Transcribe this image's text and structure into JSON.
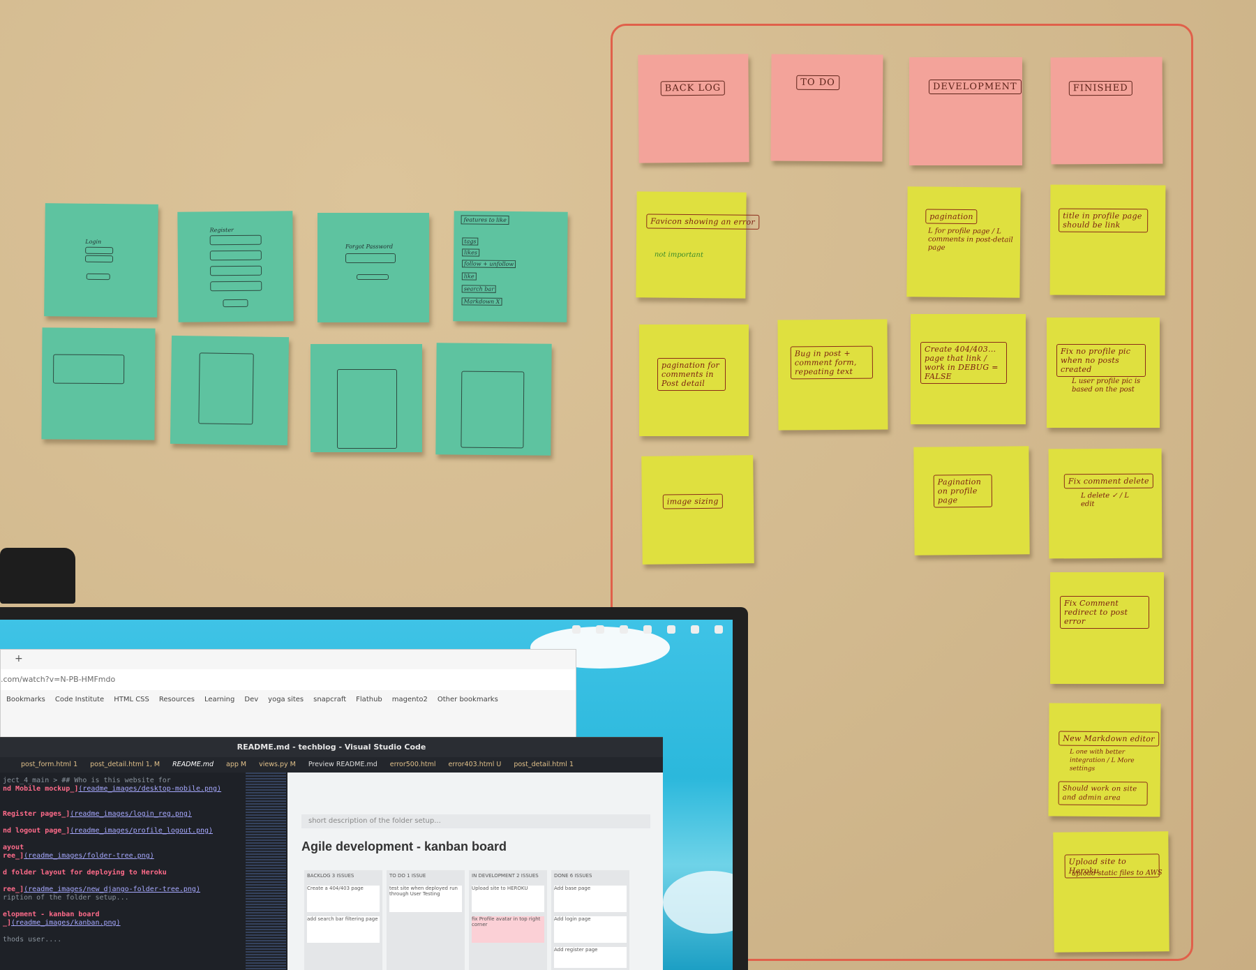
{
  "board": {
    "columns": [
      {
        "label": "BACK LOG"
      },
      {
        "label": "TO DO"
      },
      {
        "label": "DEVELOPMENT"
      },
      {
        "label": "FINISHED"
      }
    ],
    "backlog": [
      {
        "label": "Favicon showing an error",
        "note": "not important"
      },
      {
        "label": "pagination for comments in Post detail"
      },
      {
        "label": "image sizing"
      }
    ],
    "todo": [
      {
        "label": "Bug in post + comment form, repeating text"
      }
    ],
    "development": [
      {
        "label": "pagination",
        "note": "L for profile page / L comments in post-detail page"
      },
      {
        "label": "Create 404/403... page that link / work in DEBUG = FALSE"
      },
      {
        "label": "Pagination on profile page"
      }
    ],
    "finished": [
      {
        "label": "title in profile page should be link"
      },
      {
        "label": "Fix no profile pic when no posts created",
        "note": "L user profile pic is based on the post"
      },
      {
        "label": "Fix comment delete",
        "note": "L delete ✓ / L edit"
      },
      {
        "label": "Fix Comment redirect to post error"
      },
      {
        "label": "New Markdown editor",
        "note": "L one with better integration / L More settings",
        "extra": "Should work on site and admin area"
      },
      {
        "label": "Upload site to Heroku",
        "extra": "upload static files to AWS"
      }
    ]
  },
  "wireframes": {
    "notes": [
      {
        "title": "Login"
      },
      {
        "title": "Register"
      },
      {
        "title": "Forgot Password"
      },
      {
        "title": "features to like",
        "items": [
          "tags",
          "likes",
          "follow + unfollow",
          "like",
          "search bar",
          "Markdown X"
        ]
      }
    ]
  },
  "monitor": {
    "browser": {
      "url": ".com/watch?v=N-PB-HMFmdo",
      "bookmarks": [
        "Bookmarks",
        "Code Institute",
        "HTML CSS",
        "Resources",
        "Learning",
        "Dev",
        "yoga sites",
        "snapcraft",
        "Flathub",
        "magento2",
        "Other bookmarks"
      ]
    },
    "vscode": {
      "title": "README.md - techblog - Visual Studio Code",
      "tabs": [
        "post_form.html 1",
        "post_detail.html 1, M",
        "README.md",
        "app M",
        "views.py M",
        "Preview README.md",
        "error500.html",
        "error403.html U",
        "post_detail.html 1"
      ],
      "breadcrumb": "ject_4_main > ## Who is this website for",
      "lines": [
        {
          "t": "nd Mobile mockup_]",
          "l": "(readme_images/desktop-mobile.png)"
        },
        {
          "t": "Register pages_]",
          "l": "(readme_images/login_reg.png)"
        },
        {
          "t": "nd logout page_]",
          "l": "(readme_images/profile_logout.png)"
        },
        {
          "t": "ayout",
          "l": ""
        },
        {
          "t": "ree_]",
          "l": "(readme_images/folder-tree.png)"
        },
        {
          "t": "d folder layout for deploying to Heroku",
          "l": ""
        },
        {
          "t": "ree_]",
          "l": "(readme_images/new_django-folder-tree.png)"
        },
        {
          "t": "ription of the folder setup...",
          "l": ""
        },
        {
          "t": "elopment - kanban board",
          "l": ""
        },
        {
          "t": "_]",
          "l": "(readme_images/kanban.png)"
        },
        {
          "t": "thods user....",
          "l": ""
        }
      ],
      "preview": {
        "description": "short description of the folder setup...",
        "heading": "Agile development - kanban board",
        "columns": [
          {
            "title": "BACKLOG 3 ISSUES",
            "cards": [
              "Create a 404/403 page",
              "add search bar filtering page"
            ]
          },
          {
            "title": "TO DO 1 ISSUE",
            "cards": [
              "test site when deployed run through User Testing"
            ]
          },
          {
            "title": "IN DEVELOPMENT 2 ISSUES",
            "cards": [
              "Upload site to HEROKU",
              "fix Profile avatar in top right corner"
            ]
          },
          {
            "title": "DONE 6 ISSUES",
            "cards": [
              "Add base page",
              "Add login page",
              "Add register page"
            ]
          }
        ]
      }
    }
  }
}
